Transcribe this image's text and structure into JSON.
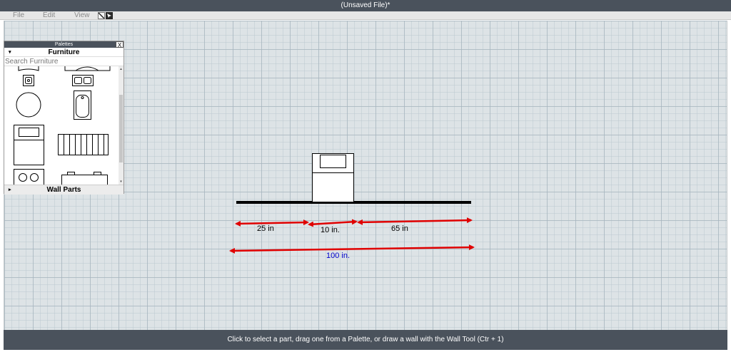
{
  "window": {
    "title": "(Unsaved File)*"
  },
  "menu": {
    "items": [
      "File",
      "Edit",
      "View"
    ]
  },
  "tools": [
    {
      "icon": "wall-tool-icon",
      "tooltip_shortcut": "Ctr + 1"
    },
    {
      "icon": "select-tool-icon"
    }
  ],
  "palette": {
    "title": "Palettes",
    "close_label": "X",
    "section_furniture": {
      "label": "Furniture",
      "toggle": "▾",
      "search_placeholder": "Search Furniture",
      "items": [
        "sink-icon",
        "double-sink-icon",
        "round-table-icon",
        "bathtub-icon",
        "bed-icon",
        "sofa-icon",
        "stove-icon",
        "dining-table-icon"
      ]
    },
    "section_wallparts": {
      "label": "Wall Parts",
      "toggle": "▸"
    },
    "scroll_up": "▴",
    "scroll_down": "▾"
  },
  "drawing": {
    "furniture_item": "stove",
    "dimensions": [
      {
        "label": "25 in"
      },
      {
        "label": "10 in."
      },
      {
        "label": "65 in"
      },
      {
        "label": "100 in.",
        "color": "#0000cc"
      }
    ],
    "arrow_color": "#e00000",
    "wall_color": "#000000"
  },
  "status": {
    "text": "Click to select a part, drag one from a Palette, or draw a wall with the Wall Tool (Ctr + 1)"
  },
  "colors": {
    "chrome": "#4a525c",
    "canvas": "#dde3e6",
    "menubar": "#e6e6e6"
  }
}
